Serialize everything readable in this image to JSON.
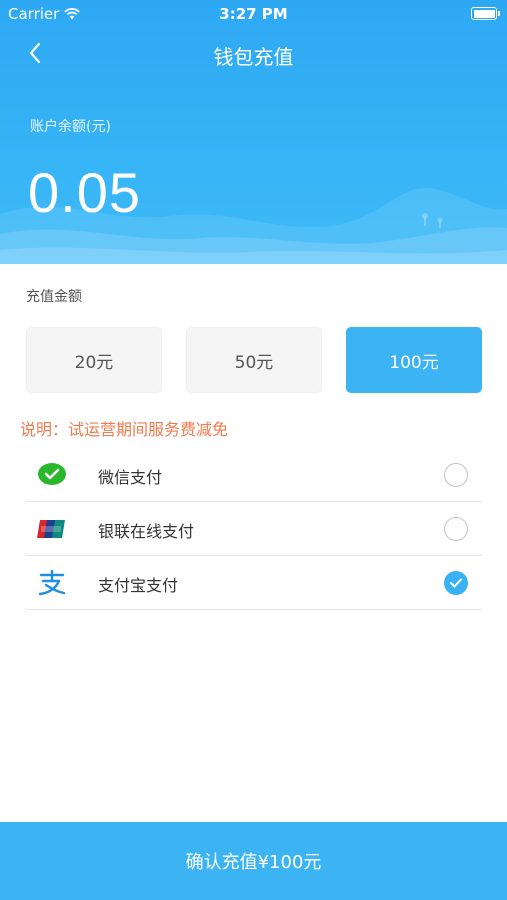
{
  "status_bar": {
    "carrier": "Carrier",
    "time": "3:27 PM"
  },
  "nav": {
    "title": "钱包充值",
    "back_icon": "chevron-left-icon"
  },
  "balance": {
    "label": "账户余额(元)",
    "value": "0.05"
  },
  "recharge": {
    "section_label": "充值金额",
    "options": [
      {
        "label": "20元",
        "selected": false
      },
      {
        "label": "50元",
        "selected": false
      },
      {
        "label": "100元",
        "selected": true
      }
    ]
  },
  "notice": "说明：试运营期间服务费减免",
  "payment_methods": [
    {
      "label": "微信支付",
      "icon": "wechat-pay-icon",
      "checked": false
    },
    {
      "label": "银联在线支付",
      "icon": "unionpay-icon",
      "checked": false
    },
    {
      "label": "支付宝支付",
      "icon": "alipay-icon",
      "checked": true
    }
  ],
  "confirm_button": "确认充值¥100元",
  "colors": {
    "accent": "#3cb4f4",
    "notice": "#f07b4f",
    "wechat": "#2bb72b",
    "alipay": "#1e8fe0"
  }
}
